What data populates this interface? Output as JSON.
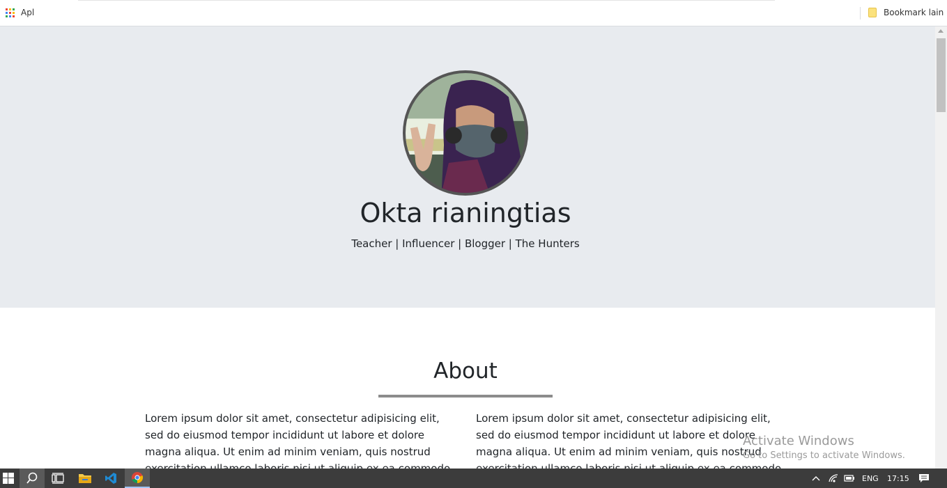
{
  "bookmarks_bar": {
    "apps_label": "Apl",
    "other_bookmarks_label": "Bookmark lain"
  },
  "profile": {
    "name": "Okta rianingtias",
    "tagline": "Teacher | Influencer | Blogger | The Hunters"
  },
  "about": {
    "title": "About",
    "column1": "Lorem ipsum dolor sit amet, consectetur adipisicing elit, sed do eiusmod tempor incididunt ut labore et dolore magna aliqua. Ut enim ad minim veniam, quis nostrud exercitation ullamco laboris nisi ut aliquip ex ea commodo consequat. Duis",
    "column2": "Lorem ipsum dolor sit amet, consectetur adipisicing elit, sed do eiusmod tempor incididunt ut labore et dolore magna aliqua. Ut enim ad minim veniam, quis nostrud exercitation ullamco laboris nisi ut aliquip ex ea commodo consequat. Duis"
  },
  "watermark": {
    "line1": "Activate Windows",
    "line2": "Go to Settings to activate Windows."
  },
  "taskbar": {
    "language": "ENG",
    "time": "17:15",
    "icons": [
      "windows-start-icon",
      "search-icon",
      "task-view-icon",
      "file-explorer-icon",
      "vscode-icon",
      "chrome-icon"
    ],
    "tray_icons": [
      "chevron-up-icon",
      "wifi-icon",
      "battery-icon",
      "notification-icon"
    ]
  },
  "colors": {
    "hero_background": "#e8ebef",
    "taskbar_background": "#3c3c3c",
    "divider": "#8c8c8c"
  }
}
